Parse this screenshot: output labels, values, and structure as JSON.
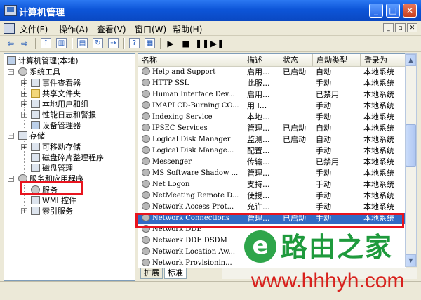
{
  "window": {
    "title": "计算机管理",
    "minimize": "_",
    "maximize": "□",
    "close": "✕"
  },
  "menu": {
    "items": [
      "文件(F)",
      "操作(A)",
      "查看(V)",
      "窗口(W)",
      "帮助(H)"
    ],
    "mdi": [
      "_",
      "▫",
      "✕"
    ]
  },
  "toolbar": {
    "icons": [
      "back-arrow-icon",
      "forward-arrow-icon",
      "up-folder-icon",
      "show-tree-icon",
      "properties-icon",
      "refresh-icon",
      "export-icon",
      "help-icon",
      "play-icon",
      "stop-icon",
      "pause-icon",
      "restart-icon"
    ]
  },
  "tree": {
    "root": "计算机管理(本地)",
    "system_tools": "系统工具",
    "event_viewer": "事件查看器",
    "shared_folders": "共享文件夹",
    "local_users": "本地用户和组",
    "perf_logs": "性能日志和警报",
    "device_manager": "设备管理器",
    "storage": "存储",
    "removable": "可移动存储",
    "defrag": "磁盘碎片整理程序",
    "disk_mgmt": "磁盘管理",
    "services_apps": "服务和应用程序",
    "services": "服务",
    "wmi": "WMI 控件",
    "indexing": "索引服务"
  },
  "list": {
    "columns": [
      "名称",
      "描述",
      "状态",
      "启动类型",
      "登录为"
    ],
    "rows": [
      [
        "Help and Support",
        "启用...",
        "已启动",
        "自动",
        "本地系统"
      ],
      [
        "HTTP SSL",
        "此服...",
        "",
        "手动",
        "本地系统"
      ],
      [
        "Human Interface Dev...",
        "启用...",
        "",
        "已禁用",
        "本地系统"
      ],
      [
        "IMAPI CD-Burning CO...",
        "用 I...",
        "",
        "手动",
        "本地系统"
      ],
      [
        "Indexing Service",
        "本地...",
        "",
        "手动",
        "本地系统"
      ],
      [
        "IPSEC Services",
        "管理...",
        "已启动",
        "自动",
        "本地系统"
      ],
      [
        "Logical Disk Manager",
        "监测...",
        "已启动",
        "自动",
        "本地系统"
      ],
      [
        "Logical Disk Manage...",
        "配置...",
        "",
        "手动",
        "本地系统"
      ],
      [
        "Messenger",
        "传输...",
        "",
        "已禁用",
        "本地系统"
      ],
      [
        "MS Software Shadow ...",
        "管理...",
        "",
        "手动",
        "本地系统"
      ],
      [
        "Net Logon",
        "支持...",
        "",
        "手动",
        "本地系统"
      ],
      [
        "NetMeeting Remote D...",
        "使授...",
        "",
        "手动",
        "本地系统"
      ],
      [
        "Network Access Prot...",
        "允许...",
        "",
        "手动",
        "本地系统"
      ],
      [
        "Network Connections",
        "管理...",
        "已启动",
        "手动",
        "本地系统"
      ],
      [
        "Network DDE",
        "",
        "",
        "",
        ""
      ],
      [
        "Network DDE DSDM",
        "",
        "",
        "",
        ""
      ],
      [
        "Network Location Aw...",
        "",
        "",
        "",
        ""
      ],
      [
        "Network Provisionin...",
        "",
        "",
        "",
        ""
      ]
    ],
    "selected_index": 13
  },
  "tabs": [
    "扩展",
    "标准"
  ],
  "watermark": {
    "brand": "路由之家",
    "url": "www.hhhyh.com"
  },
  "colors": {
    "selection": "#316ac5",
    "highlight_box": "#e8141e"
  }
}
